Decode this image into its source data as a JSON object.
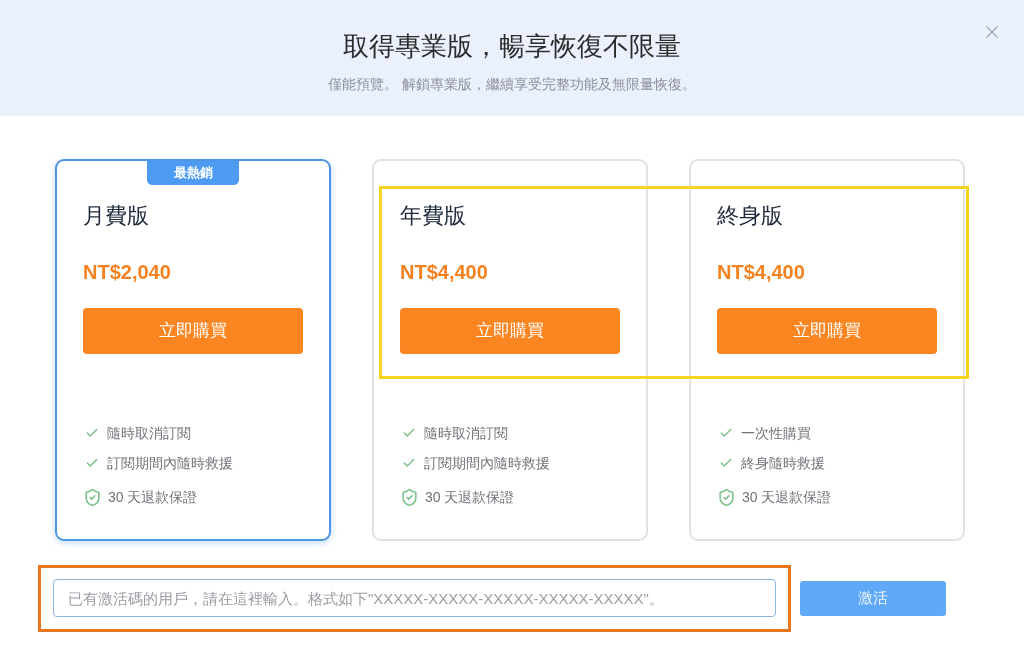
{
  "dialog": {
    "title": "取得專業版，暢享恢復不限量",
    "subtitle": "僅能預覽。 解鎖專業版，繼續享受完整功能及無限量恢復。"
  },
  "plans": [
    {
      "name": "月費版",
      "price": "NT$2,040",
      "button": "立即購買",
      "selected": true,
      "badge": "最熱銷",
      "features": [
        {
          "kind": "check",
          "text": "隨時取消訂閱"
        },
        {
          "kind": "check",
          "text": "訂閱期間內隨時救援"
        },
        {
          "kind": "guarantee",
          "text": "30 天退款保證"
        }
      ]
    },
    {
      "name": "年費版",
      "price": "NT$4,400",
      "button": "立即購買",
      "selected": false,
      "features": [
        {
          "kind": "check",
          "text": "隨時取消訂閱"
        },
        {
          "kind": "check",
          "text": "訂閱期間內隨時救援"
        },
        {
          "kind": "guarantee",
          "text": "30 天退款保證"
        }
      ]
    },
    {
      "name": "終身版",
      "price": "NT$4,400",
      "button": "立即購買",
      "selected": false,
      "features": [
        {
          "kind": "check",
          "text": "一次性購買"
        },
        {
          "kind": "check",
          "text": "終身隨時救援"
        },
        {
          "kind": "guarantee",
          "text": "30 天退款保證"
        }
      ]
    }
  ],
  "activation": {
    "placeholder": "已有激活碼的用戶，請在這裡輸入。格式如下\"XXXXX-XXXXX-XXXXX-XXXXX-XXXXX\"。",
    "button": "激活",
    "disabled": true
  },
  "highlight_frames": [
    {
      "color": "#f4d420"
    },
    {
      "color": "#e8761f"
    }
  ]
}
